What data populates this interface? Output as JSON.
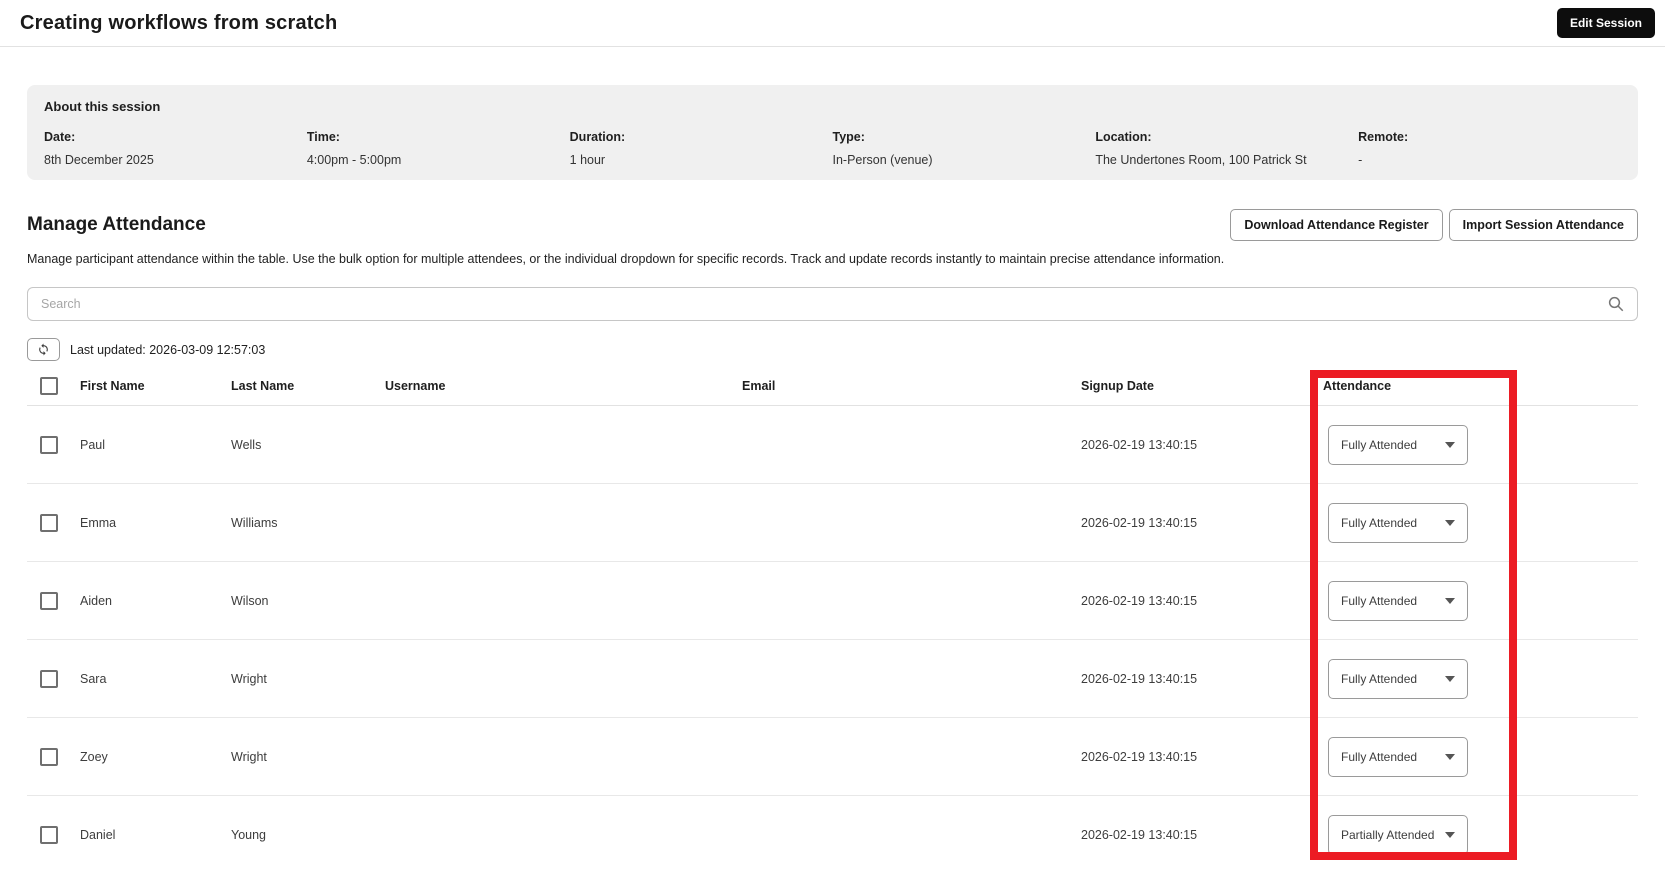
{
  "page": {
    "title": "Creating workflows from scratch"
  },
  "header": {
    "edit_session_label": "Edit Session"
  },
  "about": {
    "title": "About this session",
    "fields": [
      {
        "label": "Date:",
        "value": "8th December 2025"
      },
      {
        "label": "Time:",
        "value": "4:00pm - 5:00pm"
      },
      {
        "label": "Duration:",
        "value": "1 hour"
      },
      {
        "label": "Type:",
        "value": "In-Person (venue)"
      },
      {
        "label": "Location:",
        "value": "The Undertones Room, 100 Patrick St"
      },
      {
        "label": "Remote:",
        "value": "-"
      }
    ]
  },
  "manage": {
    "title": "Manage Attendance",
    "description": "Manage participant attendance within the table. Use the bulk option for multiple attendees, or the individual dropdown for specific records. Track and update records instantly to maintain precise attendance information.",
    "download_label": "Download Attendance Register",
    "import_label": "Import Session Attendance"
  },
  "search": {
    "placeholder": "Search",
    "icon": "search-icon"
  },
  "refresh": {
    "icon": "refresh-icon",
    "last_updated": "Last updated: 2026-03-09 12:57:03"
  },
  "table": {
    "columns": [
      "First Name",
      "Last Name",
      "Username",
      "Email",
      "Signup Date",
      "Attendance"
    ],
    "rows": [
      {
        "first_name": "Paul",
        "last_name": "Wells",
        "username": "",
        "email": "",
        "signup_date": "2026-02-19 13:40:15",
        "attendance": "Fully Attended"
      },
      {
        "first_name": "Emma",
        "last_name": "Williams",
        "username": "",
        "email": "",
        "signup_date": "2026-02-19 13:40:15",
        "attendance": "Fully Attended"
      },
      {
        "first_name": "Aiden",
        "last_name": "Wilson",
        "username": "",
        "email": "",
        "signup_date": "2026-02-19 13:40:15",
        "attendance": "Fully Attended"
      },
      {
        "first_name": "Sara",
        "last_name": "Wright",
        "username": "",
        "email": "",
        "signup_date": "2026-02-19 13:40:15",
        "attendance": "Fully Attended"
      },
      {
        "first_name": "Zoey",
        "last_name": "Wright",
        "username": "",
        "email": "",
        "signup_date": "2026-02-19 13:40:15",
        "attendance": "Fully Attended"
      },
      {
        "first_name": "Daniel",
        "last_name": "Young",
        "username": "",
        "email": "",
        "signup_date": "2026-02-19 13:40:15",
        "attendance": "Partially Attended"
      }
    ]
  },
  "colors": {
    "highlight": "#ec1c24",
    "edit_button_bg": "#0d0d0d",
    "about_box_bg": "#f0f0f0"
  }
}
